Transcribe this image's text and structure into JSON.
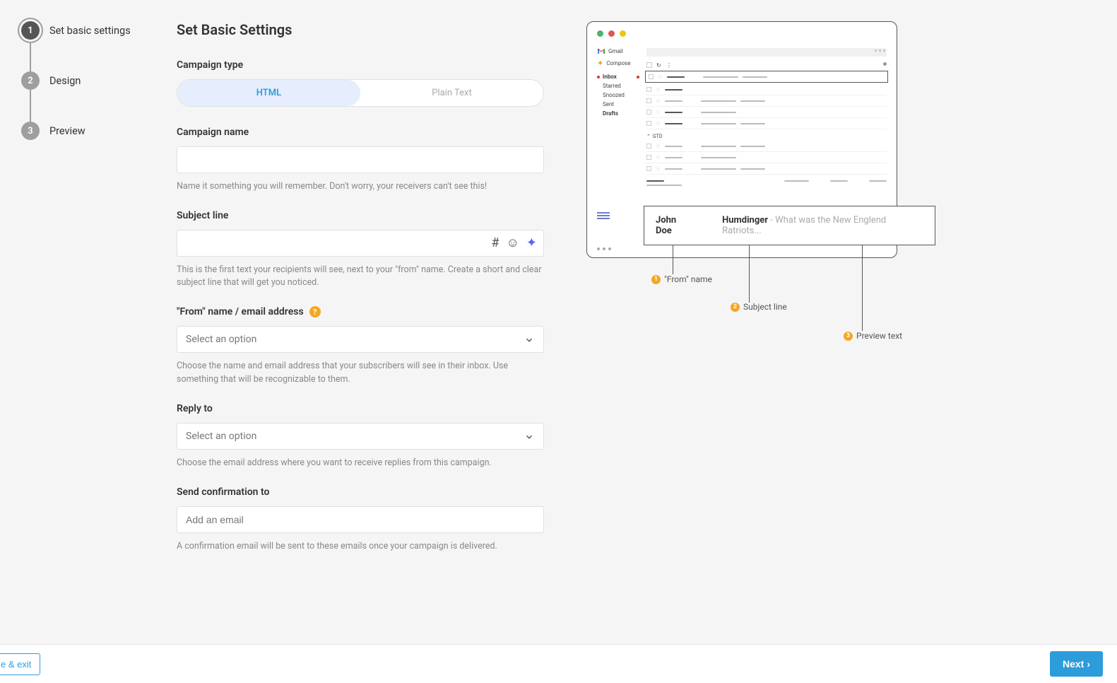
{
  "stepper": {
    "steps": [
      {
        "num": "1",
        "label": "Set basic settings"
      },
      {
        "num": "2",
        "label": "Design"
      },
      {
        "num": "3",
        "label": "Preview"
      }
    ]
  },
  "page_title": "Set Basic Settings",
  "campaign_type": {
    "label": "Campaign type",
    "options": {
      "html": "HTML",
      "plain": "Plain Text"
    }
  },
  "campaign_name": {
    "label": "Campaign name",
    "hint": "Name it something you will remember. Don't worry, your receivers can't see this!"
  },
  "subject_line": {
    "label": "Subject line",
    "hint": "This is the first text your recipients will see, next to your \"from\" name. Create a short and clear subject line that will get you noticed."
  },
  "from": {
    "label": "\"From\" name / email address",
    "placeholder": "Select an option",
    "hint": "Choose the name and email address that your subscribers will see in their inbox. Use something that will be recognizable to them."
  },
  "reply_to": {
    "label": "Reply to",
    "placeholder": "Select an option",
    "hint": "Choose the email address where you want to receive replies from this campaign."
  },
  "confirmation": {
    "label": "Send confirmation to",
    "placeholder": "Add an email",
    "hint": "A confirmation email will be sent to these emails once your campaign is delivered."
  },
  "preview_mock": {
    "gmail_label": "Gmail",
    "compose": "Compose",
    "nav": {
      "inbox": "Inbox",
      "starred": "Starred",
      "snoozed": "Snoozed",
      "sent": "Sent",
      "drafts": "Drafts"
    },
    "category": "GTD",
    "from_name": "John Doe",
    "subject": "Humdinger",
    "preview_text": "- What was the New Englend Ratriots...",
    "anno": {
      "from": "\"From\" name",
      "subject": "Subject line",
      "preview": "Preview text"
    }
  },
  "footer": {
    "save_exit": "e & exit",
    "next": "Next"
  }
}
